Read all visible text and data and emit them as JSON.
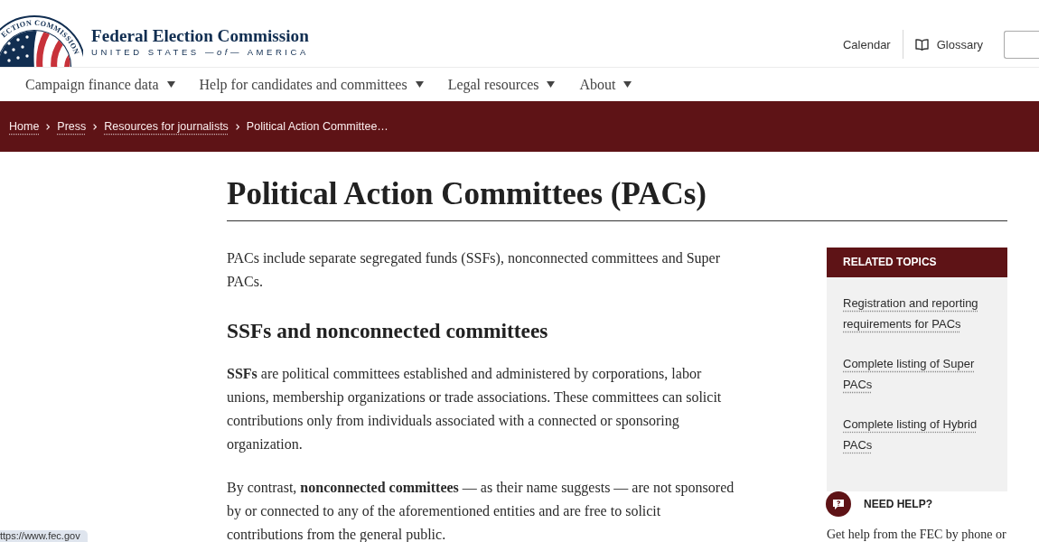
{
  "header": {
    "seal_text": "ECTION COMMISSION",
    "agency_name": "Federal Election Commission",
    "tagline": "UNITED STATES —*of*— AMERICA",
    "utility_links": [
      {
        "label": "Calendar",
        "kind": "plain"
      },
      {
        "label": "Glossary",
        "kind": "with_icon"
      }
    ]
  },
  "main_nav": [
    {
      "label": "Campaign finance data",
      "has_menu": true
    },
    {
      "label": "Help for candidates and committees",
      "has_menu": true
    },
    {
      "label": "Legal resources",
      "has_menu": true
    },
    {
      "label": "About",
      "has_menu": true
    }
  ],
  "breadcrumbs": [
    {
      "label": "Home",
      "kind": "link"
    },
    {
      "label": "Press",
      "kind": "link"
    },
    {
      "label": "Resources for journalists",
      "kind": "link"
    },
    {
      "label": "Political Action Committee…",
      "kind": "current"
    }
  ],
  "page": {
    "title": "Political Action Committees (PACs)",
    "intro": "PACs include separate segregated funds (SSFs), nonconnected committees and Super PACs.",
    "sections": [
      {
        "heading": "SSFs and nonconnected committees",
        "paragraphs": [
          "**SSFs** are political committees established and administered by corporations, labor unions, membership organizations or trade associations. These committees can solicit contributions only from individuals associated with a connected or sponsoring organization.",
          "By contrast, **nonconnected committees** — as their name suggests — are not sponsored by or connected to any of the aforementioned entities and are free to solicit contributions from the general public."
        ]
      }
    ]
  },
  "sidebar": {
    "related_topics": {
      "title": "RELATED TOPICS",
      "links": [
        "Registration and reporting requirements for PACs",
        "Complete listing of Super PACs",
        "Complete listing of Hybrid PACs"
      ]
    },
    "need_help": {
      "title": "NEED HELP?",
      "text": "Get help from the FEC by phone or"
    }
  },
  "status_bar": {
    "url": "ttps://www.fec.gov"
  }
}
